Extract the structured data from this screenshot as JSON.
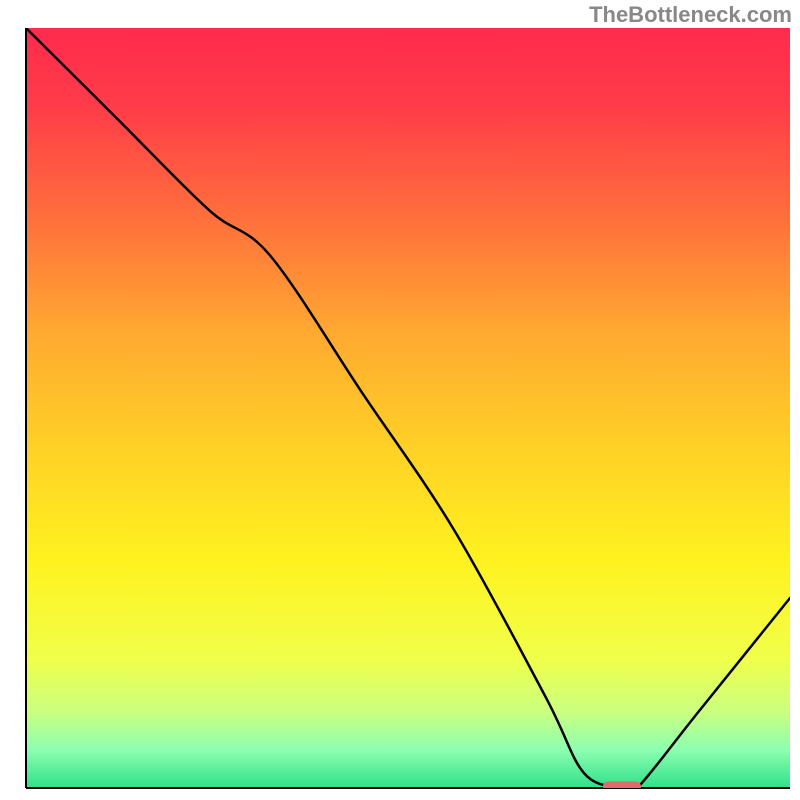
{
  "watermark": "TheBottleneck.com",
  "chart_data": {
    "type": "line",
    "title": "",
    "xlabel": "",
    "ylabel": "",
    "xlim": [
      0,
      100
    ],
    "ylim": [
      0,
      100
    ],
    "grid": false,
    "legend": false,
    "background_gradient": {
      "stops": [
        {
          "offset": 0.0,
          "color": "#ff2b4c"
        },
        {
          "offset": 0.1,
          "color": "#ff3b49"
        },
        {
          "offset": 0.25,
          "color": "#ff6f3c"
        },
        {
          "offset": 0.4,
          "color": "#ffa931"
        },
        {
          "offset": 0.55,
          "color": "#ffd026"
        },
        {
          "offset": 0.7,
          "color": "#fff21f"
        },
        {
          "offset": 0.83,
          "color": "#f0ff4a"
        },
        {
          "offset": 0.9,
          "color": "#caff80"
        },
        {
          "offset": 0.95,
          "color": "#8cffb0"
        },
        {
          "offset": 1.0,
          "color": "#2fe08a"
        }
      ]
    },
    "series": [
      {
        "name": "bottleneck-curve",
        "x": [
          0,
          12,
          24,
          32,
          44,
          56,
          68,
          73,
          78,
          80,
          88,
          100
        ],
        "y": [
          100,
          88,
          76,
          70,
          52,
          34,
          12,
          2,
          0,
          0,
          10,
          25
        ]
      }
    ],
    "marker": {
      "name": "optimal-range",
      "shape": "capsule",
      "x": 78,
      "y": 0,
      "width": 5,
      "height": 1.2,
      "color": "#e16a6a"
    }
  }
}
